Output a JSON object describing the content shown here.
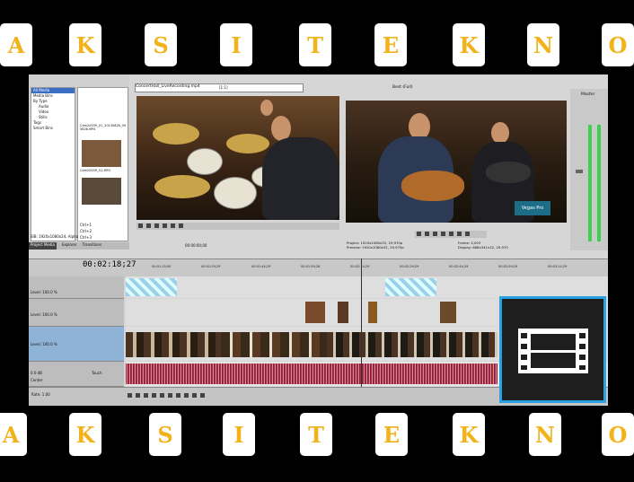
{
  "banner": {
    "letters": [
      "A",
      "K",
      "S",
      "I",
      "T",
      "E",
      "K",
      "N",
      "O"
    ]
  },
  "app": {
    "explorer": {
      "tree": [
        "All Media",
        "Media Bins",
        "By Type",
        "Audio",
        "Video",
        "Stills",
        "Tags",
        "Smart Bins"
      ],
      "clip1": "Cam20039_01_20130826_095826.MP4",
      "clip2": "Cam20039_01.MP4",
      "shortcuts": [
        "Ctrl+1",
        "Ctrl+2",
        "Ctrl+3"
      ],
      "status": "SIB: 1920x1080x24, Alpha",
      "tabs": [
        "Project Media",
        "Explorer",
        "Transitions"
      ]
    },
    "trimmer": {
      "filename": "ConcertHall_LiveRecording.mp4",
      "scale": "[1:1]",
      "time": "00:00:00;00"
    },
    "preview": {
      "quality": "Best (Full)",
      "watermark": "Vegas Pro",
      "project": "Project: 1920x1080x32, 29.970p",
      "preview": "Preview: 1920x1080x32, 29.970p",
      "frame": "Frame: 4,003",
      "display": "Display: 668x341x32, 29.970"
    },
    "master": {
      "label": "Master"
    },
    "timeline": {
      "timecode": "00:02:18;27",
      "ticks": [
        "00:01:15;00",
        "00:01:29;29",
        "00:01:44;29",
        "00:01:59;28",
        "00:02:14;29",
        "00:02:29;29",
        "00:02:44;29",
        "00:02:59;29",
        "00:03:14;29"
      ],
      "levels": [
        "Level: 100.0 %",
        "Level: 100.0 %",
        "Level: 100.0 %"
      ],
      "audio": [
        "0.0 dB",
        "Center",
        "Touch"
      ]
    },
    "footer": {
      "rate": "Rate: 1.00"
    }
  }
}
